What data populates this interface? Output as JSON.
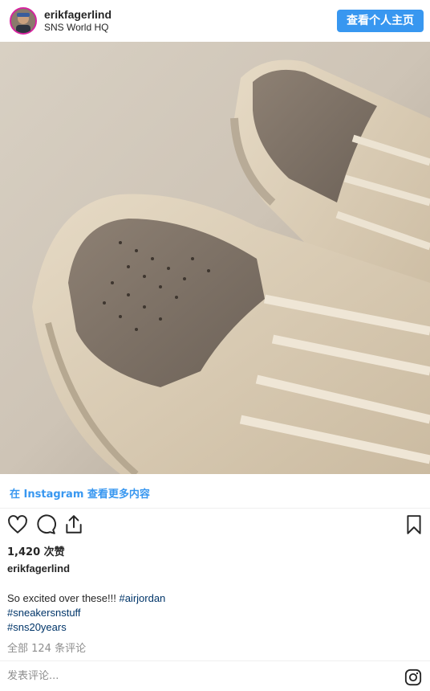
{
  "header": {
    "username": "erikfagerlind",
    "location": "SNS World HQ",
    "profile_button": "查看个人主页"
  },
  "post": {
    "view_more": "在 Instagram 查看更多内容",
    "likes": "1,420 次赞",
    "caption_user": "erikfagerlind",
    "caption_text": "So excited over these!!! ",
    "hashtags": [
      "#airjordan",
      "#sneakersnstuff",
      "#sns20years"
    ],
    "comments_link": "全部 124 条评论",
    "comment_placeholder": "发表评论..."
  },
  "colors": {
    "accent": "#3897f0",
    "hashtag": "#003569",
    "muted": "#8e8e8e"
  },
  "icons": [
    "heart-icon",
    "comment-icon",
    "share-icon",
    "bookmark-icon",
    "instagram-icon"
  ]
}
